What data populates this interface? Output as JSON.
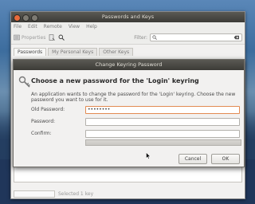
{
  "main_window": {
    "title": "Passwords and Keys",
    "menus": [
      "File",
      "Edit",
      "Remote",
      "View",
      "Help"
    ],
    "toolbar": {
      "properties_label": "Properties",
      "filter_label": "Filter:"
    },
    "tabs": [
      "Passwords",
      "My Personal Keys",
      "Other Keys"
    ],
    "status_text": "Selected 1 key"
  },
  "dialog": {
    "title": "Change Keyring Password",
    "heading": "Choose a new password for the 'Login' keyring",
    "description": "An application wants to change the password for the 'Login' keyring. Choose the new password you want to use for it.",
    "old_password_label": "Old Password:",
    "old_password_value": "••••••••",
    "password_label": "Password:",
    "confirm_label": "Confirm:",
    "cancel_label": "Cancel",
    "ok_label": "OK"
  },
  "icons": [
    "close-icon",
    "minimize-icon",
    "maximize-icon",
    "properties-icon",
    "import-icon",
    "search-icon",
    "clear-icon",
    "key-icon",
    "mouse-cursor-icon"
  ],
  "colors": {
    "titlebar": "#3c3b37",
    "close": "#e96a3b",
    "focus": "#e28a52"
  }
}
